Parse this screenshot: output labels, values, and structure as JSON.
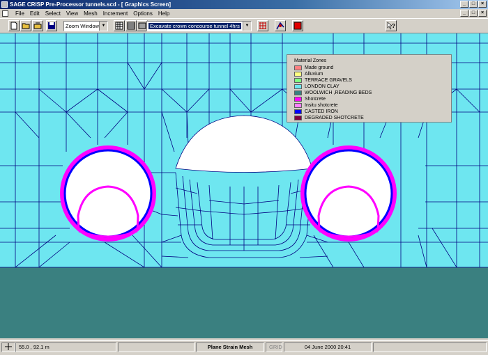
{
  "window": {
    "title": "SAGE CRISP Pre-Processor tunnels.scd - [ Graphics Screen]",
    "controls": [
      "_",
      "□",
      "×"
    ]
  },
  "menubar": {
    "items": [
      "File",
      "Edit",
      "Select",
      "View",
      "Mesh",
      "Increment",
      "Options",
      "Help"
    ],
    "mdi_controls": [
      "_",
      "□",
      "×"
    ]
  },
  "toolbar": {
    "zoom_value": "Zoom Window",
    "stage_value": "Excavate crown concourse tunnel 4hrs",
    "icons": [
      "new-file-icon",
      "open-folder-icon",
      "open-file-icon",
      "save-icon",
      "grid-icon",
      "table-icon",
      "pattern-icon",
      "mesh-icon",
      "graph-icon",
      "stop-icon",
      "help-pointer-icon"
    ]
  },
  "legend": {
    "title": "Material Zones",
    "items": [
      {
        "label": "Made ground",
        "color": "#ff8080"
      },
      {
        "label": "Alluvium",
        "color": "#ffff80"
      },
      {
        "label": "TERRACE GRAVELS",
        "color": "#80ff80"
      },
      {
        "label": "LONDON CLAY",
        "color": "#6ee6f0"
      },
      {
        "label": "WOOLWICH ,READING BEDS",
        "color": "#3a8080"
      },
      {
        "label": "Shotcrete",
        "color": "#ff00ff"
      },
      {
        "label": "Insitu shotcrete",
        "color": "#ff80ff"
      },
      {
        "label": "CASTED IRON",
        "color": "#0000ff"
      },
      {
        "label": "DEGRADED SHOTCRETE",
        "color": "#800040"
      }
    ]
  },
  "status": {
    "coords": "55.0 , 92.1 m",
    "mode": "Plane Strain Mesh",
    "grid": "GRID",
    "datetime": "04 June 2000 20:41"
  },
  "colors": {
    "mesh_line": "#000080",
    "london_clay": "#6ee6f0",
    "woolwich": "#3a8080",
    "shotcrete": "#ff00ff",
    "cast_iron": "#0000ff"
  }
}
